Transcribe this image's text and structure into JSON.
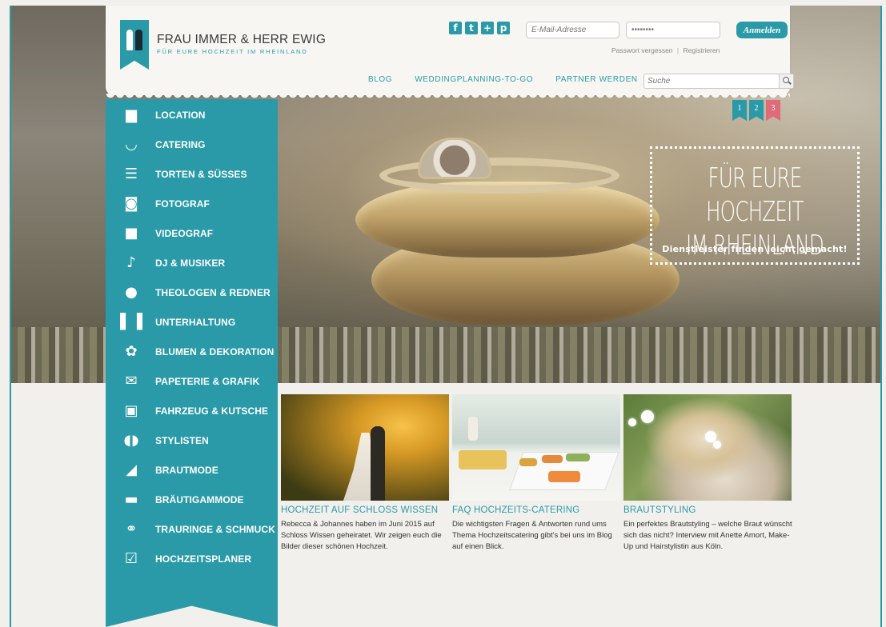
{
  "brand": {
    "title": "FRAU IMMER & HERR EWIG",
    "subtitle": "FÜR EURE HOCHZEIT IM RHEINLAND"
  },
  "social": [
    {
      "name": "facebook-icon",
      "glyph": "f"
    },
    {
      "name": "twitter-icon",
      "glyph": "t"
    },
    {
      "name": "googleplus-icon",
      "glyph": "+"
    },
    {
      "name": "pinterest-icon",
      "glyph": "p"
    }
  ],
  "login": {
    "email_placeholder": "E-Mail-Adresse",
    "password_value": "••••••••",
    "button_label": "Anmelden",
    "forgot_label": "Passwort vergessen",
    "separator": "|",
    "register_label": "Registrieren"
  },
  "nav": {
    "blog": "BLOG",
    "planning": "WEDDINGPLANNING-TO-GO",
    "partner": "PARTNER WERDEN",
    "search_placeholder": "Suche"
  },
  "slider": {
    "tabs": [
      {
        "label": "1",
        "color": "#2a9aa8"
      },
      {
        "label": "2",
        "color": "#2a9aa8"
      },
      {
        "label": "3",
        "color": "#e06b78"
      }
    ],
    "headline": "FÜR EURE HOCHZEIT\nIM RHEINLAND",
    "subline": "Dienstleister finden leicht gemacht!"
  },
  "sidebar": {
    "items": [
      {
        "label": "LOCATION",
        "icon": "building-icon",
        "glyph": "▆"
      },
      {
        "label": "CATERING",
        "icon": "bowl-icon",
        "glyph": "◡"
      },
      {
        "label": "TORTEN & SÜSSES",
        "icon": "cake-icon",
        "glyph": "☰"
      },
      {
        "label": "FOTOGRAF",
        "icon": "camera-icon",
        "glyph": "◙"
      },
      {
        "label": "VIDEOGRAF",
        "icon": "videocamera-icon",
        "glyph": "■"
      },
      {
        "label": "DJ & MUSIKER",
        "icon": "guitar-icon",
        "glyph": "♪"
      },
      {
        "label": "THEOLOGEN & REDNER",
        "icon": "speech-bubble-icon",
        "glyph": "●"
      },
      {
        "label": "UNTERHALTUNG",
        "icon": "curtain-icon",
        "glyph": "▌▐"
      },
      {
        "label": "BLUMEN & DEKORATION",
        "icon": "flower-icon",
        "glyph": "✿"
      },
      {
        "label": "PAPETERIE & GRAFIK",
        "icon": "envelope-icon",
        "glyph": "✉"
      },
      {
        "label": "FAHRZEUG & KUTSCHE",
        "icon": "car-icon",
        "glyph": "▣"
      },
      {
        "label": "STYLISTEN",
        "icon": "lips-icon",
        "glyph": "◖◗"
      },
      {
        "label": "BRAUTMODE",
        "icon": "high-heel-icon",
        "glyph": "◢"
      },
      {
        "label": "BRÄUTIGAMMODE",
        "icon": "men-shoe-icon",
        "glyph": "▬"
      },
      {
        "label": "TRAURINGE & SCHMUCK",
        "icon": "rings-icon",
        "glyph": "⚭"
      },
      {
        "label": "HOCHZEITSPLANER",
        "icon": "checkbox-icon",
        "glyph": "☑"
      }
    ]
  },
  "teasers": [
    {
      "title": "HOCHZEIT AUF SCHLOSS WISSEN",
      "text": "Rebecca & Johannes haben im Juni 2015 auf Schloss Wissen geheiratet. Wir zeigen euch die Bilder dieser schönen Hochzeit."
    },
    {
      "title": "FAQ HOCHZEITS-CATERING",
      "text": "Die wichtigsten Fragen & Antworten rund ums Thema Hochzeitscatering gibt's bei uns im Blog auf einen Blick."
    },
    {
      "title": "BRAUTSTYLING",
      "text": "Ein perfektes Brautstyling – welche Braut wünscht sich das nicht? Interview mit Anette Amort, Make-Up und Hairstylistin aus Köln."
    }
  ],
  "colors": {
    "accent": "#2a9aa8",
    "highlight": "#e06b78",
    "background": "#f2f0ec"
  }
}
